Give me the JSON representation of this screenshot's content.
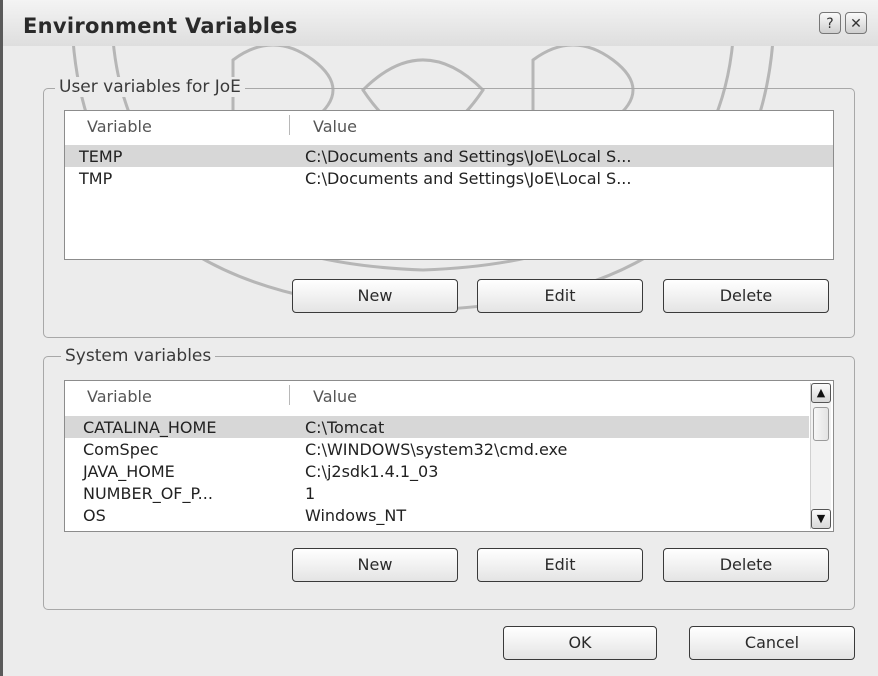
{
  "window": {
    "title": "Environment Variables",
    "help_icon": "help-icon",
    "close_icon": "close-icon"
  },
  "user_variables": {
    "group_label": "User variables for JoE",
    "columns": [
      "Variable",
      "Value"
    ],
    "rows": [
      {
        "variable": "TEMP",
        "value": "C:\\Documents and Settings\\JoE\\Local S...",
        "selected": true
      },
      {
        "variable": "TMP",
        "value": "C:\\Documents and Settings\\JoE\\Local S...",
        "selected": false
      }
    ],
    "buttons": {
      "new": "New",
      "edit": "Edit",
      "delete": "Delete"
    }
  },
  "system_variables": {
    "group_label": "System variables",
    "columns": [
      "Variable",
      "Value"
    ],
    "rows": [
      {
        "variable": "CATALINA_HOME",
        "value": "C:\\Tomcat",
        "selected": true
      },
      {
        "variable": "ComSpec",
        "value": "C:\\WINDOWS\\system32\\cmd.exe",
        "selected": false
      },
      {
        "variable": "JAVA_HOME",
        "value": "C:\\j2sdk1.4.1_03",
        "selected": false
      },
      {
        "variable": "NUMBER_OF_P...",
        "value": "1",
        "selected": false
      },
      {
        "variable": "OS",
        "value": "Windows_NT",
        "selected": false
      }
    ],
    "buttons": {
      "new": "New",
      "edit": "Edit",
      "delete": "Delete"
    },
    "scroll_up_icon": "chevron-up-icon",
    "scroll_down_icon": "chevron-down-icon"
  },
  "footer": {
    "ok": "OK",
    "cancel": "Cancel"
  },
  "colors": {
    "background": "#ececec",
    "selection": "#d7d7d7",
    "border": "#a8a8a8"
  }
}
